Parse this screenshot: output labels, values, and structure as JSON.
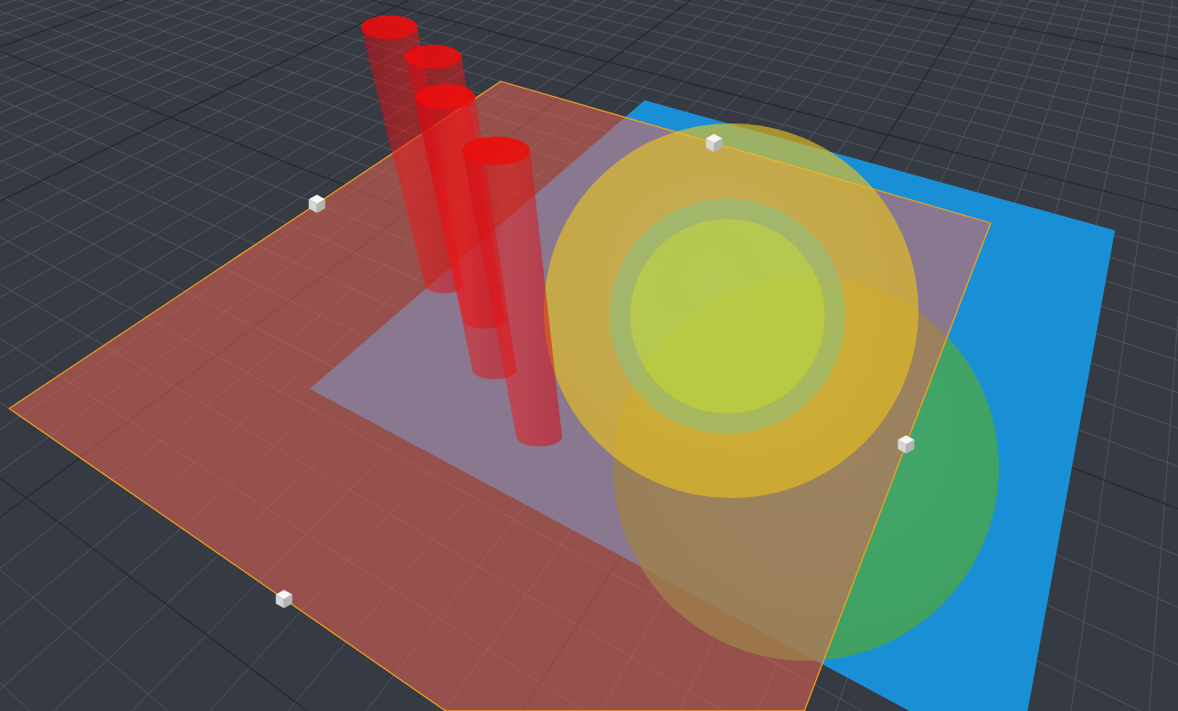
{
  "viewport": {
    "planes": [
      {
        "selected": false
      },
      {
        "selected": true
      }
    ],
    "spheres": [
      {
        "selected": false
      },
      {
        "selected": false
      }
    ],
    "cylinders": [
      {
        "selected": false
      },
      {
        "selected": false
      },
      {
        "selected": false
      },
      {
        "selected": false
      }
    ]
  }
}
